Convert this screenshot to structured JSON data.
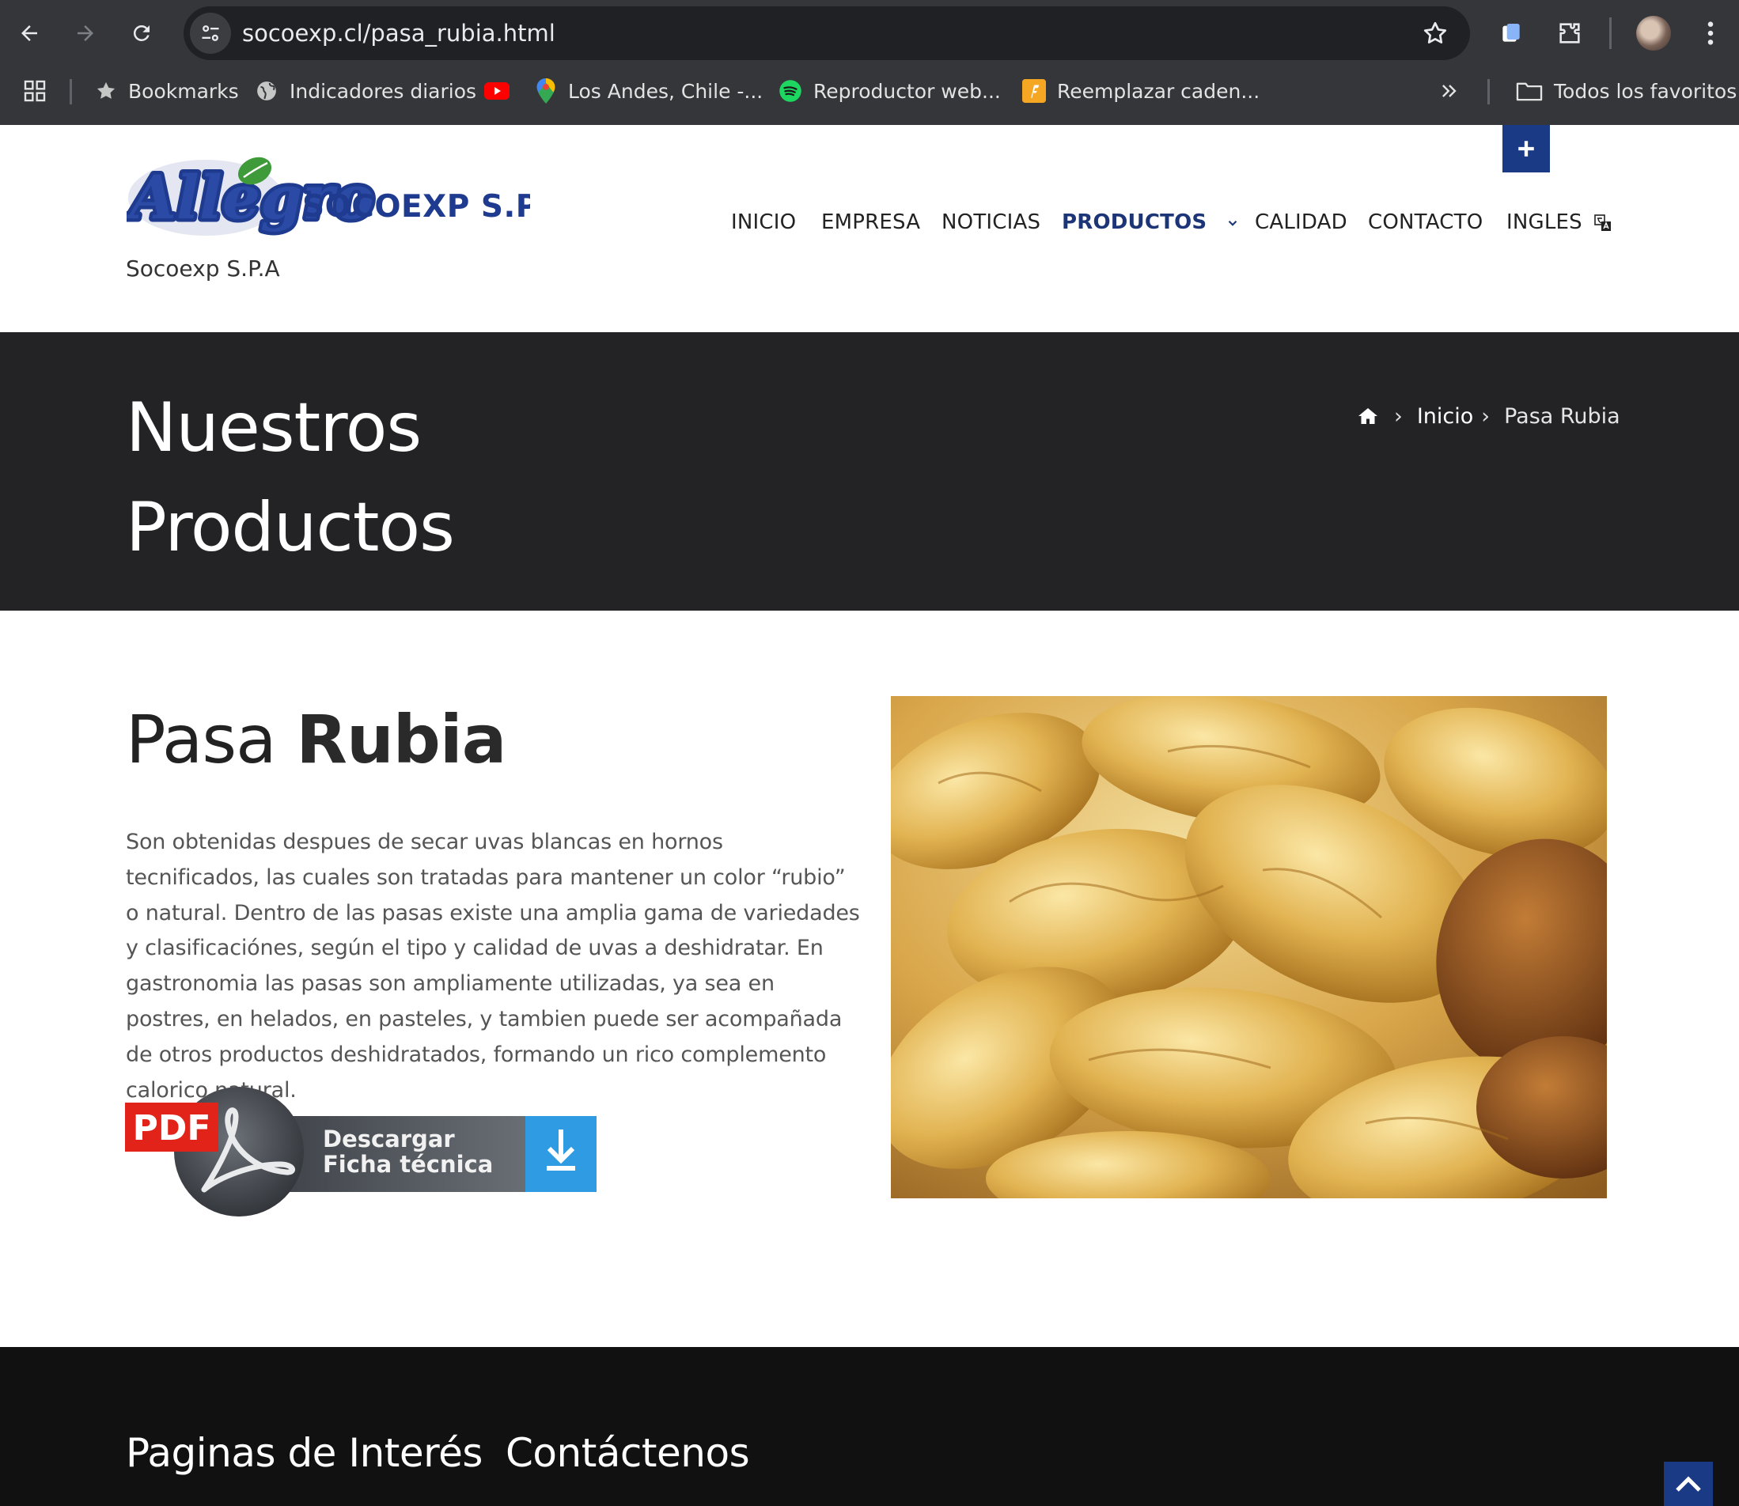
{
  "browser": {
    "url": "socoexp.cl/pasa_rubia.html",
    "bookmarks": [
      {
        "label": "Bookmarks",
        "icon": "star-icon"
      },
      {
        "label": "Indicadores diarios",
        "icon": "globe-icon"
      },
      {
        "label": "",
        "icon": "youtube-icon"
      },
      {
        "label": "Los Andes, Chile -...",
        "icon": "maps-pin-icon"
      },
      {
        "label": "Reproductor web...",
        "icon": "spotify-icon"
      },
      {
        "label": "Reemplazar caden...",
        "icon": "bookmark-favicon-icon"
      }
    ],
    "all_bookmarks": "Todos los favoritos"
  },
  "site": {
    "logo_brand": "Allegro",
    "logo_company": "SOCOEXP S.P.A.",
    "tagline": "Socoexp S.P.A",
    "menu": [
      {
        "label": "INICIO"
      },
      {
        "label": "EMPRESA"
      },
      {
        "label": "NOTICIAS"
      },
      {
        "label": "PRODUCTOS"
      },
      {
        "label": "CALIDAD"
      },
      {
        "label": "CONTACTO"
      },
      {
        "label": "INGLES"
      }
    ],
    "accent_color": "#1b3a86"
  },
  "title_band": {
    "title": "Nuestros Productos",
    "breadcrumb": [
      "Inicio",
      "Pasa Rubia"
    ]
  },
  "product": {
    "name_light": "Pasa",
    "name_bold": "Rubia",
    "description": "Son obtenidas despues de secar uvas blancas en hornos tecnificados, las cuales son tratadas para mantener un color “rubio” o natural. Dentro de las pasas existe una amplia gama de variedades y clasificaciónes, según el tipo y calidad de uvas a deshidratar. En gastronomia las pasas son ampliamente utilizadas, ya sea en postres, en helados, en pasteles, y tambien puede ser acompañada de otros productos deshidratados, formando un rico complemento calorico natural.",
    "pdf_badge": "PDF",
    "pdf_line1": "Descargar",
    "pdf_line2": "Ficha técnica"
  },
  "footer": {
    "col1_title": "Paginas de Interés",
    "col2_title": "Contáctenos"
  }
}
